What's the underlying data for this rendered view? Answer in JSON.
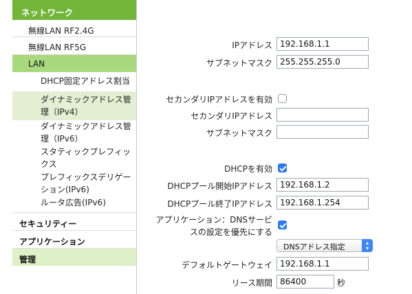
{
  "sidebar": {
    "header": "ネットワーク",
    "items": [
      "無線LAN RF2.4G",
      "無線LAN RF5G",
      "LAN"
    ],
    "lan_sub_items": [
      "DHCP固定アドレス割当",
      "ダイナミックアドレス管理（IPv4）",
      "ダイナミックアドレス管理（IPv6）",
      "スタティックプレフィックス",
      "プレフィックスデリゲーション(IPv6)",
      "ルータ広告(IPv6)"
    ],
    "sections": [
      "セキュリティー",
      "アプリケーション",
      "管理"
    ]
  },
  "form": {
    "ip_address": {
      "label": "IPアドレス",
      "value": "192.168.1.1"
    },
    "subnet_mask": {
      "label": "サブネットマスク",
      "value": "255.255.255.0"
    },
    "secondary_ip_enable": {
      "label": "セカンダリIPアドレスを有効",
      "checked": false
    },
    "secondary_ip": {
      "label": "セカンダリIPアドレス",
      "value": ""
    },
    "secondary_subnet": {
      "label": "サブネットマスク",
      "value": ""
    },
    "dhcp_enable": {
      "label": "DHCPを有効",
      "checked": true
    },
    "dhcp_start": {
      "label": "DHCPプール開始IPアドレス",
      "value": "192.168.1.2"
    },
    "dhcp_end": {
      "label": "DHCPプール終了IPアドレス",
      "value": "192.168.1.254"
    },
    "app_dns_priority": {
      "label_line1": "アプリケーション：DNSサービ",
      "label_line2": "スの設定を優先にする",
      "checked": true
    },
    "dns_mode": {
      "selected": "DNSアドレス指定"
    },
    "default_gateway": {
      "label": "デフォルトゲートウェイ",
      "value": "192.168.1.1"
    },
    "lease_time": {
      "label": "リース期間",
      "value": "86400",
      "unit": "秒"
    }
  },
  "colors": {
    "nav_header": "#72b539",
    "lan_active": "#a9d97e",
    "sub_highlight": "#e2efd3",
    "admin_bg": "#dff0c6",
    "checkbox_on": "#2f7cf6"
  }
}
